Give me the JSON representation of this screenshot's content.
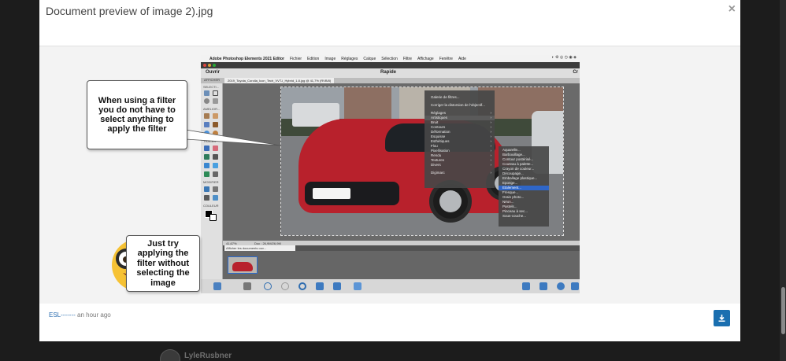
{
  "modal": {
    "title": "Document preview of image 2).jpg",
    "close_glyph": "×",
    "author_name": "ESL-------",
    "timestamp": "an hour ago",
    "download_icon": "download-icon"
  },
  "background": {
    "username": "LyleRusbner"
  },
  "screenshot": {
    "mac_menu": [
      "Adobe Photoshop Elements 2021 Editor",
      "Fichier",
      "Edition",
      "Image",
      "Réglages",
      "Calque",
      "Sélection",
      "Filtre",
      "Affichage",
      "Fenêtre",
      "Aide"
    ],
    "toolbar_left": "Ouvrir",
    "toolbar_mode": "Rapide",
    "toolbar_right": "Cr",
    "afficher": "AFFICHER",
    "doc_tab": "2019_Toyota_Corolla_Icon_Tech_VVT-i_Hybrid_1.8.jpg @ 41,7% (RVB/8)",
    "tool_labels": [
      "SELECTI...",
      "AMELIOR...",
      "TRACER",
      "MODIFIER",
      "COULEUR"
    ],
    "filter_menu": {
      "items_top": [
        "Galerie de filtres...",
        "Corriger la distorsion de l'objectif..."
      ],
      "items": [
        "Réglages",
        "Artistiques",
        "Bruit",
        "Contours",
        "Déformation",
        "Esquisse",
        "Esthétiques",
        "Flou",
        "Pixellisation",
        "Rendu",
        "Textures",
        "Divers"
      ],
      "item_bottom": "Digimarc"
    },
    "artistic_submenu": [
      "Aquarelle...",
      "Barbouillage...",
      "Contour postérisé...",
      "Couteau à palette...",
      "Crayon de couleur...",
      "Découpage...",
      "Emballage plastique...",
      "Eponge...",
      "Etalement...",
      "Fresque...",
      "Grain photo...",
      "Néon...",
      "Pastels...",
      "Pinceau à sec...",
      "Sous-couche..."
    ],
    "status_zoom": "41,67%",
    "status_doc": "Doc : 26,9M/26,9M",
    "bin_select": "Afficher les documents ouv..."
  },
  "callouts": {
    "top": "When using a filter you do not have to select anything to apply the filter",
    "bottom": "Just try applying the filter without selecting the image"
  },
  "colors": {
    "accent": "#1a6fb0",
    "car_red": "#b8212c",
    "menu_highlight": "#2f66c7"
  }
}
